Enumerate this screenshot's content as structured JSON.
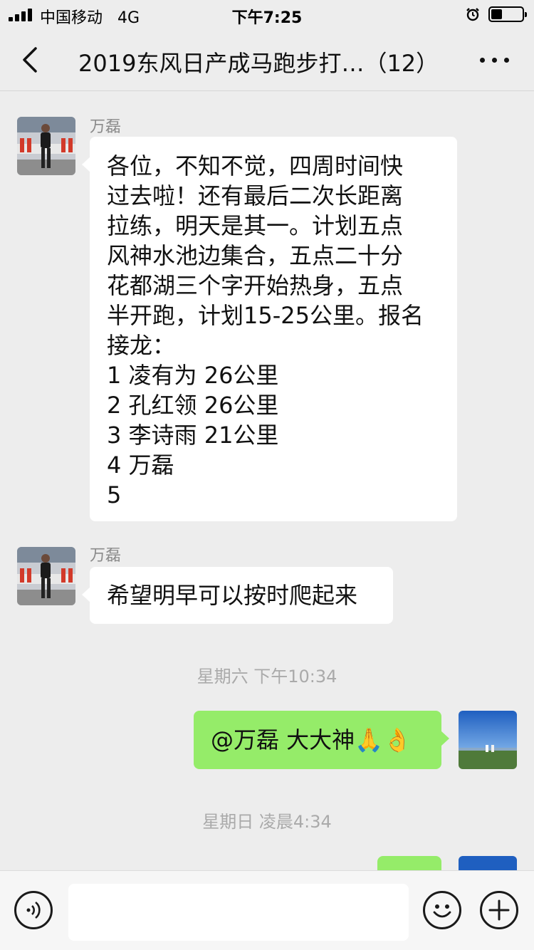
{
  "status_bar": {
    "carrier": "中国移动",
    "network": "4G",
    "time": "下午7:25",
    "battery_level": 0.35
  },
  "nav": {
    "title": "2019东风日产成马跑步打…（12）",
    "back_icon": "chevron-left-icon",
    "more_icon": "more-dots-icon"
  },
  "messages": [
    {
      "sender": "万磊",
      "direction": "incoming",
      "lines": [
        "各位，不知不觉，四周时间快",
        "过去啦！还有最后二次长距离",
        "拉练，明天是其一。计划五点",
        "风神水池边集合，五点二十分",
        "花都湖三个字开始热身，五点",
        "半开跑，计划15-25公里。报名",
        "接龙：",
        "1 凌有为 26公里",
        "2 孔红领 26公里",
        "3 李诗雨 21公里",
        "4 万磊",
        "5"
      ]
    },
    {
      "sender": "万磊",
      "direction": "incoming",
      "text": "希望明早可以按时爬起来"
    },
    {
      "timestamp": "星期六 下午10:34"
    },
    {
      "direction": "outgoing",
      "text": "@万磊 大大神🙏👌"
    },
    {
      "timestamp": "星期日 凌晨4:34"
    }
  ],
  "input_bar": {
    "voice_icon": "voice-icon",
    "emoji_icon": "emoji-icon",
    "add_icon": "plus-icon",
    "placeholder": ""
  },
  "colors": {
    "background": "#ededed",
    "incoming_bubble": "#ffffff",
    "outgoing_bubble": "#95ec69",
    "timestamp_text": "#aaaaaa"
  }
}
